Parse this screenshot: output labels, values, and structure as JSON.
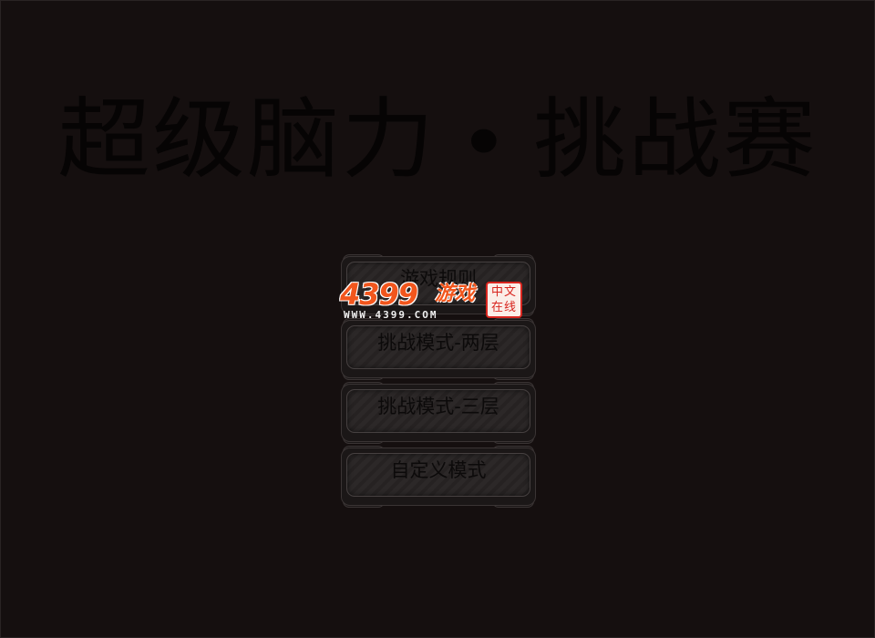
{
  "game": {
    "title": "超级脑力 • 挑战赛"
  },
  "menu": {
    "items": [
      {
        "label": "游戏规则"
      },
      {
        "label": "挑战模式-两层"
      },
      {
        "label": "挑战模式-三层"
      },
      {
        "label": "自定义模式"
      }
    ]
  },
  "watermark": {
    "brand_number": "4399",
    "brand_text": "游戏",
    "url": "WWW.4399.COM",
    "seal_text": "中文\n在线"
  },
  "colors": {
    "background": "#150f0f",
    "button_fill": "#2c2828",
    "text_dark": "#060404",
    "brand_orange": "#f2561d",
    "seal_red": "#d8261f"
  }
}
